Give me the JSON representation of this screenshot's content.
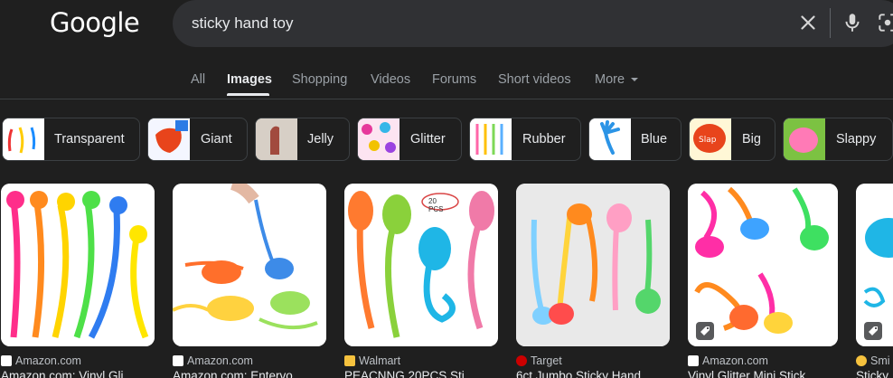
{
  "header": {
    "logo": "Google",
    "query": "sticky hand toy"
  },
  "tabs": [
    {
      "label": "All"
    },
    {
      "label": "Images"
    },
    {
      "label": "Shopping"
    },
    {
      "label": "Videos"
    },
    {
      "label": "Forums"
    },
    {
      "label": "Short videos"
    },
    {
      "label": "More"
    }
  ],
  "chips": [
    {
      "label": "Transparent"
    },
    {
      "label": "Giant"
    },
    {
      "label": "Jelly"
    },
    {
      "label": "Glitter"
    },
    {
      "label": "Rubber"
    },
    {
      "label": "Blue"
    },
    {
      "label": "Big"
    },
    {
      "label": "Slappy"
    }
  ],
  "results": [
    {
      "source": "Amazon.com",
      "title": "Amazon.com: Vinyl Gli..."
    },
    {
      "source": "Amazon.com",
      "title": "Amazon.com: Entervo..."
    },
    {
      "source": "Walmart",
      "title": "PEACNNG 20PCS Sti...",
      "badge": "20 PCS"
    },
    {
      "source": "Target",
      "title": "6ct Jumbo Sticky Hand..."
    },
    {
      "source": "Amazon.com",
      "title": "Vinyl Glitter Mini Stick..."
    },
    {
      "source": "Smi",
      "title": "Sticky"
    }
  ],
  "colors": {
    "background": "#1f1f1f",
    "search_bg": "#303134",
    "text": "#e8eaed",
    "muted": "#9aa0a6"
  }
}
